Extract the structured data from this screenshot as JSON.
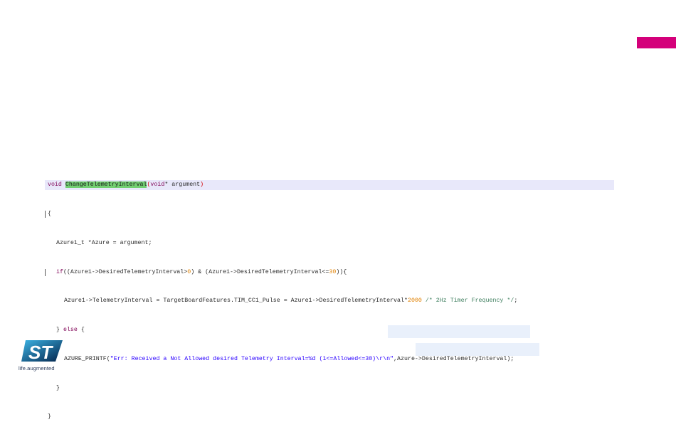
{
  "brand": {
    "accent_color": "#d4007a",
    "logo_icon": "st-logo-icon",
    "logo_text": "ST",
    "tagline": "life.augmented"
  },
  "code": {
    "line1": {
      "kw": "void",
      "fn": "ChangeTelemetryInterval",
      "open": "(",
      "kw2": "void",
      "rest": "* argument",
      "close": ")"
    },
    "line2": "{",
    "line3": "Azure1_t *Azure = argument;",
    "line4": {
      "kw": "if",
      "a": "((Azure1->DesiredTelemetryInterval>",
      "n1": "0",
      "b": ") & (Azure1->DesiredTelemetryInterval<=",
      "n2": "30",
      "c": ")){"
    },
    "line5": {
      "a": "Azure1->TelemetryInterval = TargetBoardFeatures.TIM_CC1_Pulse = Azure1->DesiredTelemetryInterval*",
      "n": "2000",
      "cmt": "/* 2Hz Timer Frequency */",
      "end": ";"
    },
    "line6": {
      "a": "} ",
      "kw": "else",
      "b": " {"
    },
    "line7": {
      "a": "AZURE_PRINTF(",
      "str": "\"Err: Received a Not Allowed desired Telemetry Interval=%d (1<=Allowed<=30)\\r\\n\"",
      "b": ",Azure->DesiredTelemetryInterval);"
    },
    "line8": "}",
    "line9": "}"
  }
}
